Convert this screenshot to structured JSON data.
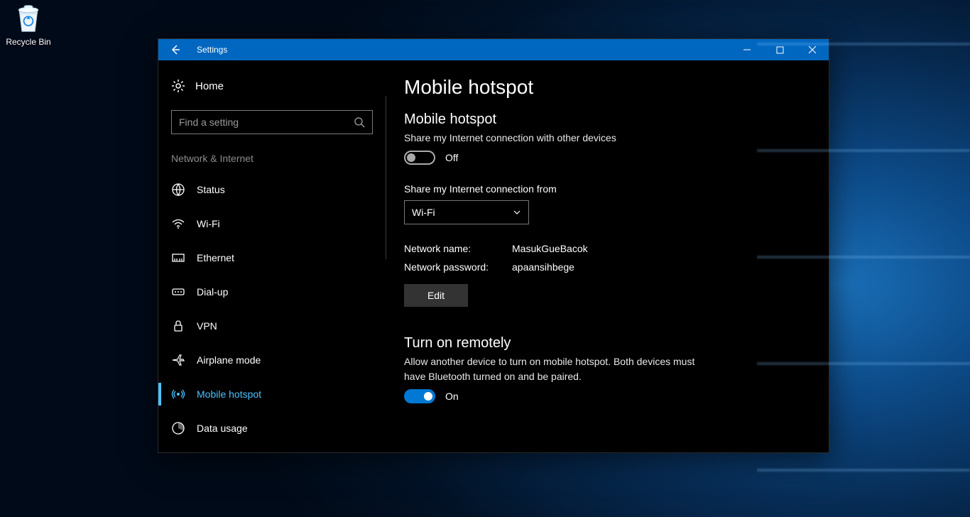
{
  "desktop": {
    "recycle_bin_label": "Recycle Bin"
  },
  "window": {
    "title": "Settings"
  },
  "sidebar": {
    "home": "Home",
    "search_placeholder": "Find a setting",
    "section": "Network & Internet",
    "items": [
      {
        "label": "Status",
        "icon": "globe-icon"
      },
      {
        "label": "Wi-Fi",
        "icon": "wifi-icon"
      },
      {
        "label": "Ethernet",
        "icon": "ethernet-icon"
      },
      {
        "label": "Dial-up",
        "icon": "dialup-icon"
      },
      {
        "label": "VPN",
        "icon": "vpn-icon"
      },
      {
        "label": "Airplane mode",
        "icon": "airplane-icon"
      },
      {
        "label": "Mobile hotspot",
        "icon": "hotspot-icon",
        "active": true
      },
      {
        "label": "Data usage",
        "icon": "datausage-icon"
      }
    ]
  },
  "content": {
    "page_title": "Mobile hotspot",
    "section1": {
      "heading": "Mobile hotspot",
      "desc": "Share my Internet connection with other devices",
      "toggle_state": "Off"
    },
    "share_from": {
      "label": "Share my Internet connection from",
      "selected": "Wi-Fi"
    },
    "network": {
      "name_label": "Network name:",
      "name_value": "MasukGueBacok",
      "password_label": "Network password:",
      "password_value": "apaansihbege",
      "edit_label": "Edit"
    },
    "remote": {
      "heading": "Turn on remotely",
      "desc": "Allow another device to turn on mobile hotspot. Both devices must have Bluetooth turned on and be paired.",
      "toggle_state": "On"
    }
  }
}
